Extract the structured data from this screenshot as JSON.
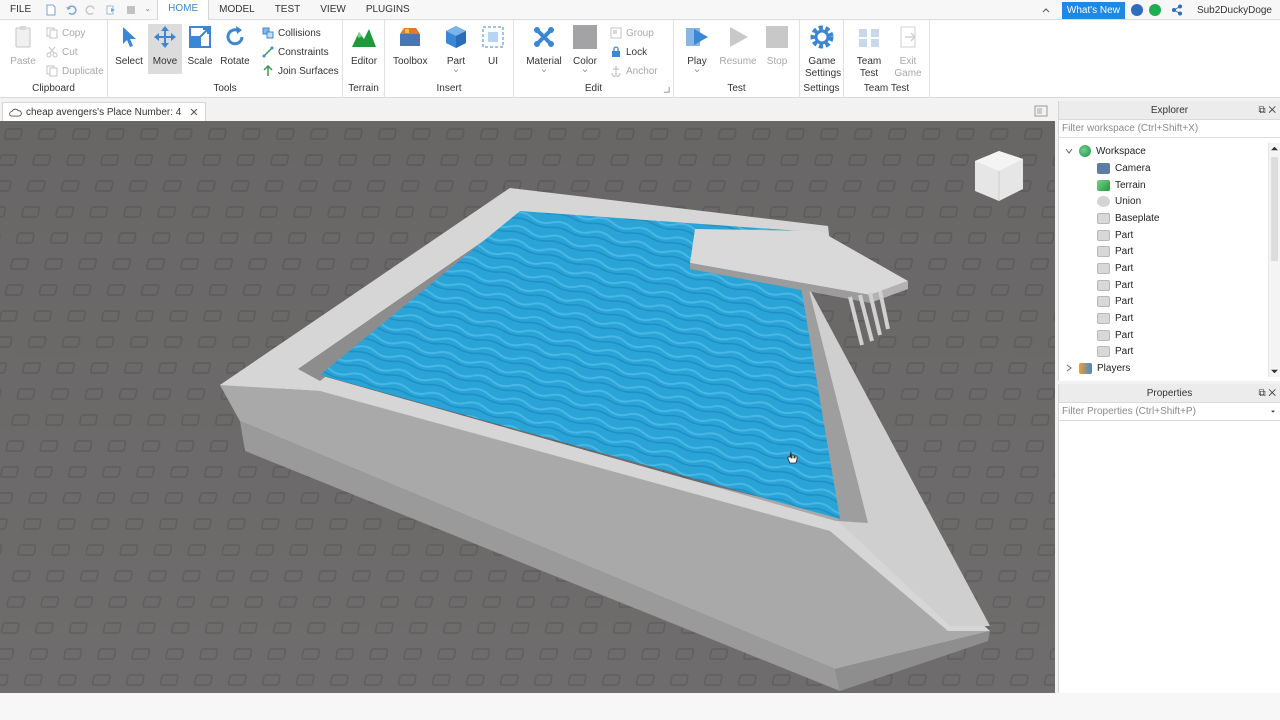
{
  "menubar": {
    "file": "FILE",
    "tabs": [
      "HOME",
      "MODEL",
      "TEST",
      "VIEW",
      "PLUGINS"
    ],
    "whats_new": "What's New",
    "username": "Sub2DuckyDoge"
  },
  "ribbon": {
    "clipboard": {
      "paste": "Paste",
      "copy": "Copy",
      "cut": "Cut",
      "duplicate": "Duplicate",
      "label": "Clipboard"
    },
    "tools": {
      "select": "Select",
      "move": "Move",
      "scale": "Scale",
      "rotate": "Rotate",
      "collisions": "Collisions",
      "constraints": "Constraints",
      "join_surfaces": "Join Surfaces",
      "label": "Tools"
    },
    "terrain": {
      "editor": "Editor",
      "label": "Terrain"
    },
    "insert": {
      "toolbox": "Toolbox",
      "part": "Part",
      "ui": "UI",
      "label": "Insert"
    },
    "edit": {
      "material": "Material",
      "color": "Color",
      "group": "Group",
      "lock": "Lock",
      "anchor": "Anchor",
      "label": "Edit"
    },
    "test": {
      "play": "Play",
      "resume": "Resume",
      "stop": "Stop",
      "label": "Test"
    },
    "settings": {
      "game_settings_1": "Game",
      "game_settings_2": "Settings",
      "label": "Settings"
    },
    "team_test": {
      "team_test_1": "Team",
      "team_test_2": "Test",
      "exit_game_1": "Exit",
      "exit_game_2": "Game",
      "label": "Team Test"
    }
  },
  "doc_tab": {
    "title": "cheap avengers's Place Number: 4"
  },
  "explorer": {
    "title": "Explorer",
    "filter_placeholder": "Filter workspace (Ctrl+Shift+X)",
    "items": [
      "Workspace",
      "Camera",
      "Terrain",
      "Union",
      "Baseplate",
      "Part",
      "Part",
      "Part",
      "Part",
      "Part",
      "Part",
      "Part",
      "Part",
      "Players"
    ]
  },
  "properties": {
    "title": "Properties",
    "filter_placeholder": "Filter Properties (Ctrl+Shift+P)"
  },
  "colors": {
    "accent": "#3a87d6",
    "water": "#2aa3d6",
    "pool_wall": "#c9c9c9",
    "baseplate": "#6a6767"
  }
}
